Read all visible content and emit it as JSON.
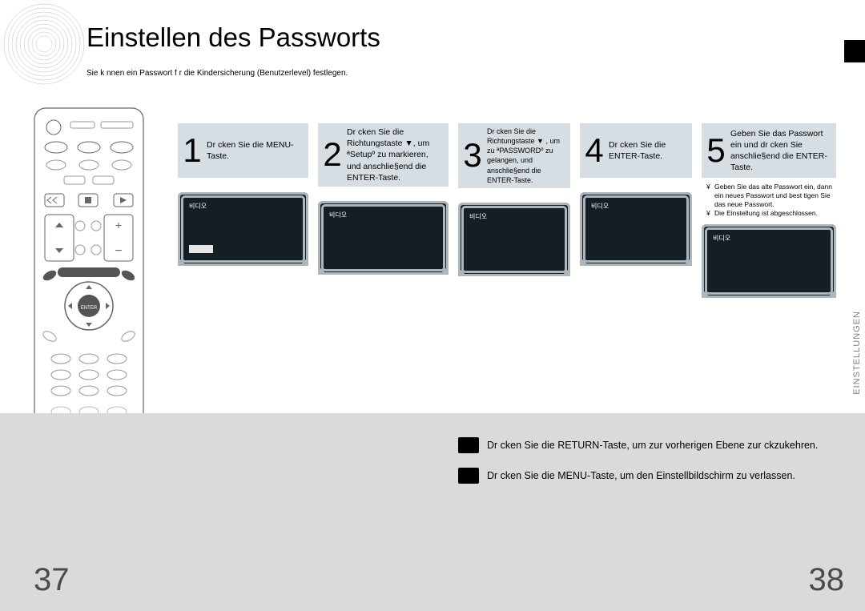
{
  "title": "Einstellen des Passworts",
  "subtitle": "Sie k  nnen ein Passwort f  r die Kindersicherung (Benutzerlevel) festlegen.",
  "side_tab": "EINSTELLUNGEN",
  "steps": [
    {
      "num": "1",
      "text": "Dr  cken Sie die MENU-Taste."
    },
    {
      "num": "2",
      "text": "Dr  cken Sie die Richtungstaste ▼, um ªSetupº zu markieren, und anschlie§end die ENTER-Taste."
    },
    {
      "num": "3",
      "text": "Dr  cken Sie die Richtungstaste ▼ , um zu ªPASSWORDº zu gelangen, und anschlie§end die ENTER-Taste."
    },
    {
      "num": "4",
      "text": "Dr  cken Sie die ENTER-Taste."
    },
    {
      "num": "5",
      "text": "Geben Sie das Passwort ein und dr  cken Sie anschlie§end die ENTER-Taste."
    }
  ],
  "notes5": [
    "Geben Sie das alte Passwort ein, dann ein neues Passwort und best  tigen Sie das neue Passwort.",
    "Die Einstellung ist abgeschlossen."
  ],
  "note_bullet": "¥",
  "screen_korean": "비디오",
  "footer": {
    "return": "Dr  cken Sie die RETURN-Taste, um zur vorherigen Ebene zur  ckzukehren.",
    "menu": "Dr  cken Sie die MENU-Taste, um den Einstellbildschirm zu verlassen."
  },
  "page_left": "37",
  "page_right": "38"
}
